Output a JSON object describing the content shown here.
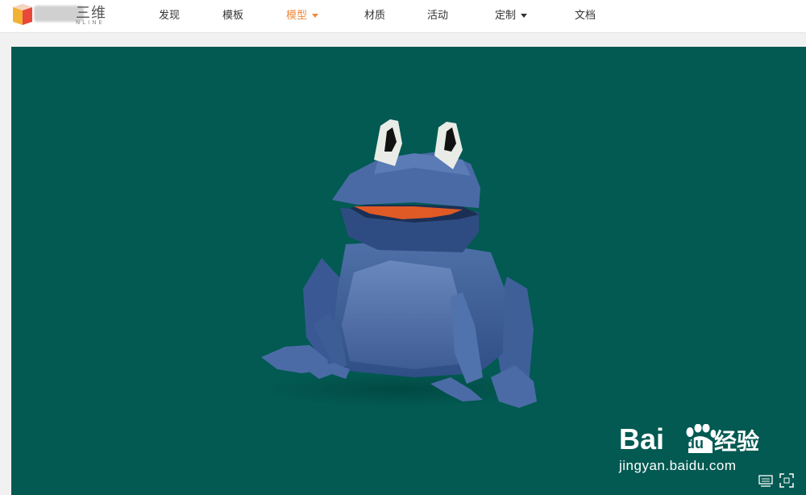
{
  "header": {
    "logo": {
      "text_cn": "三维",
      "text_en": "NLINE"
    },
    "nav": [
      {
        "label": "发现",
        "active": false,
        "dropdown": false
      },
      {
        "label": "模板",
        "active": false,
        "dropdown": false
      },
      {
        "label": "模型",
        "active": true,
        "dropdown": true
      },
      {
        "label": "材质",
        "active": false,
        "dropdown": false
      },
      {
        "label": "活动",
        "active": false,
        "dropdown": false
      },
      {
        "label": "定制",
        "active": false,
        "dropdown": true
      },
      {
        "label": "文档",
        "active": false,
        "dropdown": false
      }
    ]
  },
  "viewer": {
    "background": "#025a52",
    "model": "frog-3d-model",
    "controls": [
      "keyboard-icon",
      "fullscreen-icon"
    ]
  },
  "watermark": {
    "brand_left": "Bai",
    "brand_du": "du",
    "brand_right": "经验",
    "url": "jingyan.baidu.com"
  },
  "colors": {
    "accent": "#f08a3c",
    "viewer_bg": "#025a52"
  }
}
